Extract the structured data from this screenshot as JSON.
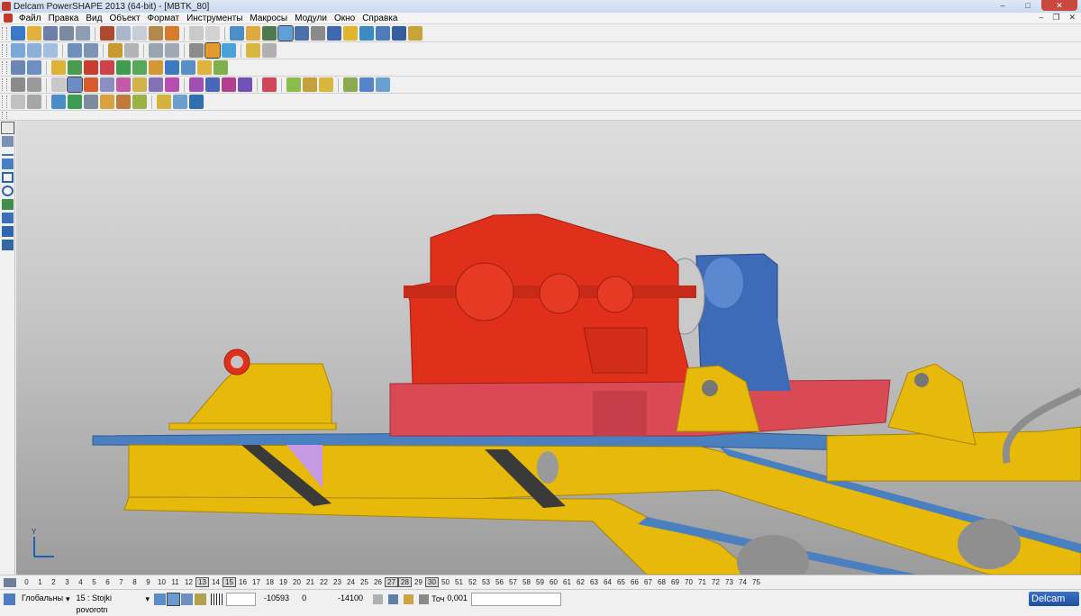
{
  "window": {
    "title": "Delcam PowerSHAPE 2013 (64-bit) - [MBTK_80]",
    "minimize": "–",
    "maximize": "□",
    "close": "✕"
  },
  "menu": [
    "Файл",
    "Правка",
    "Вид",
    "Объект",
    "Формат",
    "Инструменты",
    "Макросы",
    "Модули",
    "Окно",
    "Справка"
  ],
  "mdi_controls": {
    "minimize": "–",
    "restore": "❐",
    "close": "✕"
  },
  "toolbars": {
    "row1_count": 31,
    "row2_count": 20,
    "row3_count": 13,
    "row4_count": 18,
    "row5_count": 12
  },
  "viewport": {
    "axis_label_y": "Y",
    "colors": {
      "gearbox": "#e0301c",
      "frame": "#e7b90a",
      "base": "#d94a55",
      "motor": "#3d6bb8",
      "plate": "#4a7fc0",
      "accent_purple": "#c79ae6"
    }
  },
  "levels": {
    "items": [
      "0",
      "1",
      "2",
      "3",
      "4",
      "5",
      "6",
      "7",
      "8",
      "9",
      "10",
      "11",
      "12",
      "13",
      "14",
      "15",
      "16",
      "17",
      "18",
      "19",
      "20",
      "21",
      "22",
      "23",
      "24",
      "25",
      "26",
      "27",
      "28",
      "29",
      "30",
      "50",
      "51",
      "52",
      "53",
      "56",
      "57",
      "58",
      "59",
      "60",
      "61",
      "62",
      "63",
      "64",
      "65",
      "66",
      "67",
      "68",
      "69",
      "70",
      "71",
      "72",
      "73",
      "74",
      "75"
    ],
    "active": [
      "13",
      "15",
      "27",
      "28",
      "30"
    ]
  },
  "status": {
    "workplane": "Глобальны",
    "level": "15 : Stojki povorotn",
    "x": "-10593",
    "y": "0",
    "z": "-14100",
    "tolerance_label": "Точ",
    "tolerance_value": "0,001",
    "brand": "Delcam"
  }
}
